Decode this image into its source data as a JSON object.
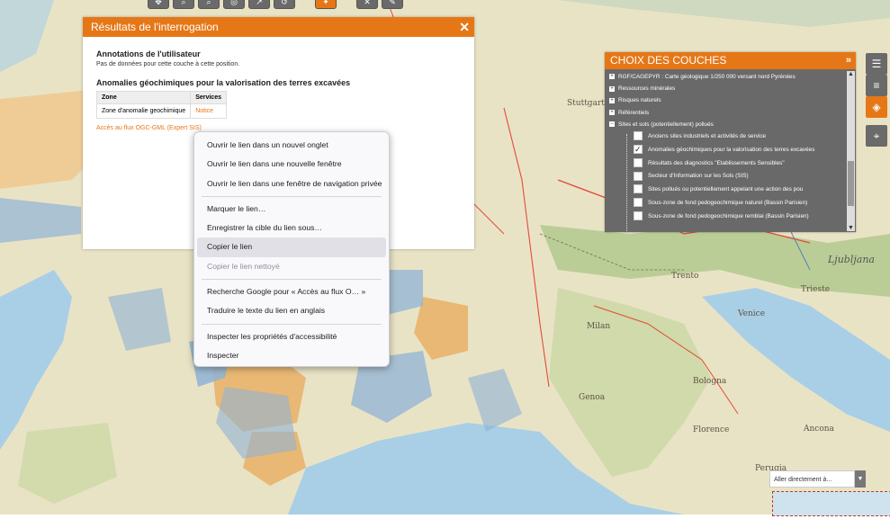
{
  "map": {
    "labels": [
      "Stuttgart",
      "Ljubljana",
      "Trento",
      "Trieste",
      "Milan",
      "Venice",
      "Bologna",
      "Genoa",
      "Florence",
      "Ancona",
      "Perugia"
    ]
  },
  "toolbar": {
    "icons": [
      "zoom-in-icon",
      "zoom-out-icon",
      "zoom-box-icon",
      "identify-icon",
      "measure-icon",
      "print-icon",
      "info-icon",
      "tools-icon",
      "share-icon"
    ]
  },
  "results": {
    "title": "Résultats de l'interrogation",
    "section1_title": "Annotations de l'utilisateur",
    "section1_text": "Pas de données pour cette couche à cette position.",
    "section2_title": "Anomalies géochimiques pour la valorisation des terres excavées",
    "table_headers": [
      "Zone",
      "Services"
    ],
    "table_rows": [
      {
        "zone": "Zone d'anomalie geochimique",
        "service": "Notice"
      }
    ],
    "flux_link": "Accès au flux OGC-GML (Expert SIS)"
  },
  "context_menu": {
    "items": [
      {
        "label": "Ouvrir le lien dans un nouvel onglet",
        "state": "normal"
      },
      {
        "label": "Ouvrir le lien dans une nouvelle fenêtre",
        "state": "normal"
      },
      {
        "label": "Ouvrir le lien dans une fenêtre de navigation privée",
        "state": "normal"
      },
      {
        "label": "Marquer le lien…",
        "state": "normal"
      },
      {
        "label": "Enregistrer la cible du lien sous…",
        "state": "normal"
      },
      {
        "label": "Copier le lien",
        "state": "highlighted"
      },
      {
        "label": "Copier le lien nettoyé",
        "state": "disabled"
      },
      {
        "label": "Recherche Google pour « Accès au flux O… »",
        "state": "normal"
      },
      {
        "label": "Traduire le texte du lien en anglais",
        "state": "normal"
      },
      {
        "label": "Inspecter les propriétés d'accessibilité",
        "state": "normal"
      },
      {
        "label": "Inspecter",
        "state": "normal"
      }
    ]
  },
  "layers": {
    "title": "CHOIX DES COUCHES",
    "groups": [
      {
        "label": "RGF/CAGEPYR : Carte géologique 1/250 000 versant nord Pyrénées",
        "expander": "+"
      },
      {
        "label": "Ressources minérales",
        "expander": "+"
      },
      {
        "label": "Risques naturels",
        "expander": "+"
      },
      {
        "label": "Référentiels",
        "expander": "+"
      },
      {
        "label": "Sites et sols (potentiellement) pollués",
        "expander": "−"
      }
    ],
    "sublayers": [
      {
        "label": "Anciens sites industriels et activités de service",
        "checked": false
      },
      {
        "label": "Anomalies géochimiques pour la valorisation des terres excavées",
        "checked": true
      },
      {
        "label": "Résultats des diagnostics \"Etablissements Sensibles\"",
        "checked": false
      },
      {
        "label": "Secteur d'Information sur les Sols (SIS)",
        "checked": false
      },
      {
        "label": "Sites pollués ou potentiellement appelant une action des pou",
        "checked": false
      },
      {
        "label": "Sous-zone de fond pedogeochimique naturel (Bassin Parisien)",
        "checked": false
      },
      {
        "label": "Sous-zone de fond pedogeochimique remblai (Bassin Parisien)",
        "checked": false
      }
    ]
  },
  "right_tools": [
    "layers-icon",
    "legend-icon",
    "map-select-icon",
    "locate-icon"
  ],
  "goto": {
    "label": "Aller directement à..."
  },
  "colors": {
    "accent": "#e67717",
    "panel": "#696969",
    "sea": "#a9cfe6",
    "land": "#e8e3c6"
  }
}
